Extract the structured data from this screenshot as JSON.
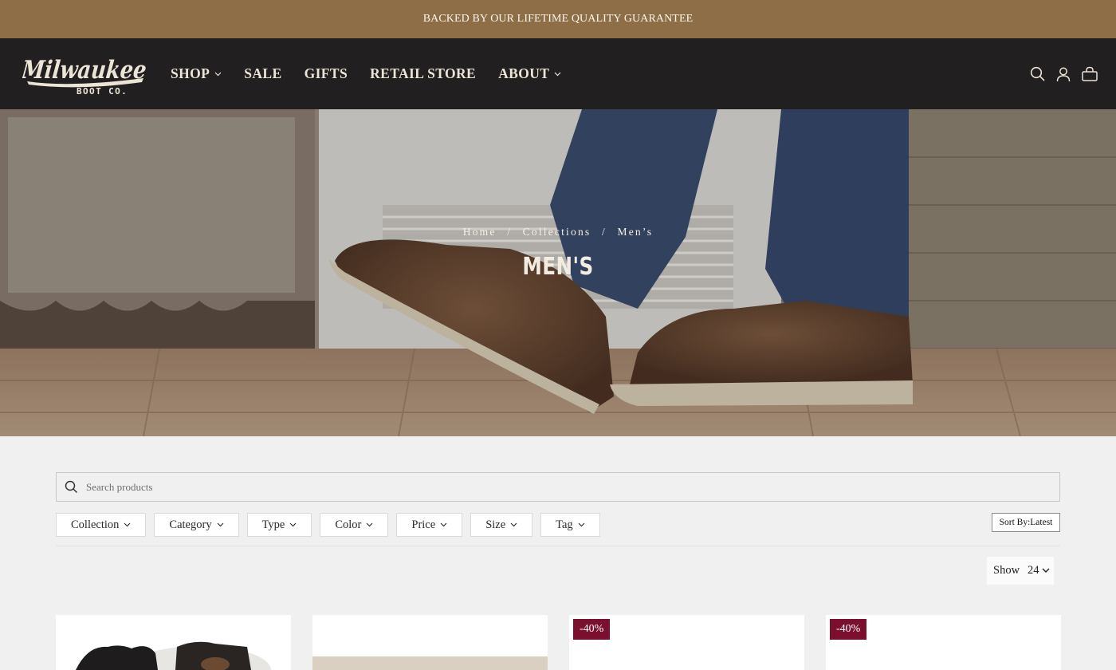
{
  "announcement": "BACKED BY OUR LIFETIME QUALITY GUARANTEE",
  "brand": {
    "logo_script": "Milwaukee",
    "logo_sub": "BOOT CO."
  },
  "nav": [
    {
      "label": "SHOP",
      "has_dropdown": true
    },
    {
      "label": "SALE",
      "has_dropdown": false
    },
    {
      "label": "GIFTS",
      "has_dropdown": false
    },
    {
      "label": "RETAIL STORE",
      "has_dropdown": false
    },
    {
      "label": "ABOUT",
      "has_dropdown": true
    }
  ],
  "header_icons": [
    "search-icon",
    "account-icon",
    "cart-icon"
  ],
  "hero": {
    "breadcrumb": [
      "Home",
      "Collections",
      "Men’s"
    ],
    "separator": "/",
    "title": "MEN'S"
  },
  "search": {
    "placeholder": "Search products",
    "value": ""
  },
  "filters": [
    "Collection",
    "Category",
    "Type",
    "Color",
    "Price",
    "Size",
    "Tag"
  ],
  "sort": {
    "label": "Sort By:",
    "value": "Latest"
  },
  "show": {
    "label": "Show",
    "value": "24"
  },
  "products": [
    {
      "badge": ""
    },
    {
      "badge": ""
    },
    {
      "badge": "-40%"
    },
    {
      "badge": "-40%"
    }
  ],
  "colors": {
    "announcement_bg": "#8d6e47",
    "header_bg": "#221f21",
    "badge_bg": "#7a0f2e",
    "page_bg": "#f0f0f0"
  }
}
